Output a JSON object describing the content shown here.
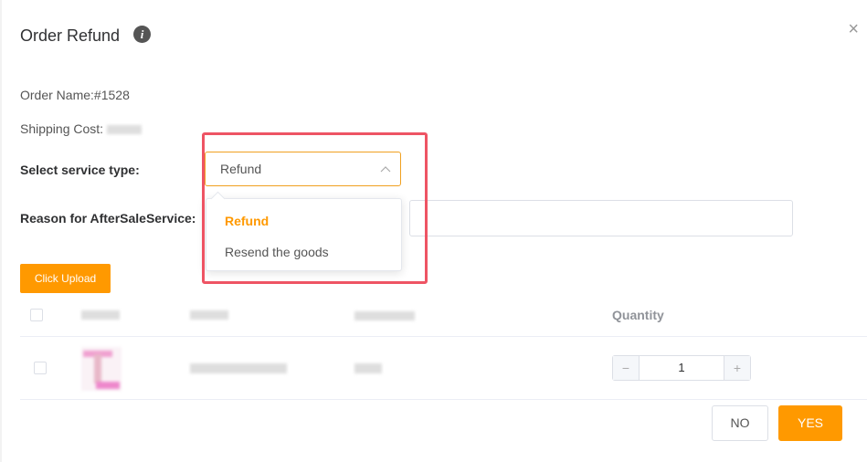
{
  "dialog": {
    "title": "Order Refund",
    "info_icon": "info-icon",
    "close_icon": "close-icon",
    "close_glyph": "×"
  },
  "order": {
    "name_label": "Order Name:",
    "name_value": "#1528",
    "shipping_label": "Shipping Cost:"
  },
  "form": {
    "service_type_label": "Select service type:",
    "service_type_value": "Refund",
    "service_type_options": [
      "Refund",
      "Resend the goods"
    ],
    "reason_label": "Reason for AfterSaleService:",
    "reason_value": ""
  },
  "upload": {
    "button_label": "Click Upload"
  },
  "table": {
    "quantity_header": "Quantity",
    "rows": [
      {
        "quantity": "1"
      }
    ]
  },
  "stepper": {
    "minus": "−",
    "plus": "+"
  },
  "footer": {
    "no_label": "NO",
    "yes_label": "YES"
  },
  "colors": {
    "accent": "#ff9900",
    "highlight_border": "#ee5464"
  }
}
